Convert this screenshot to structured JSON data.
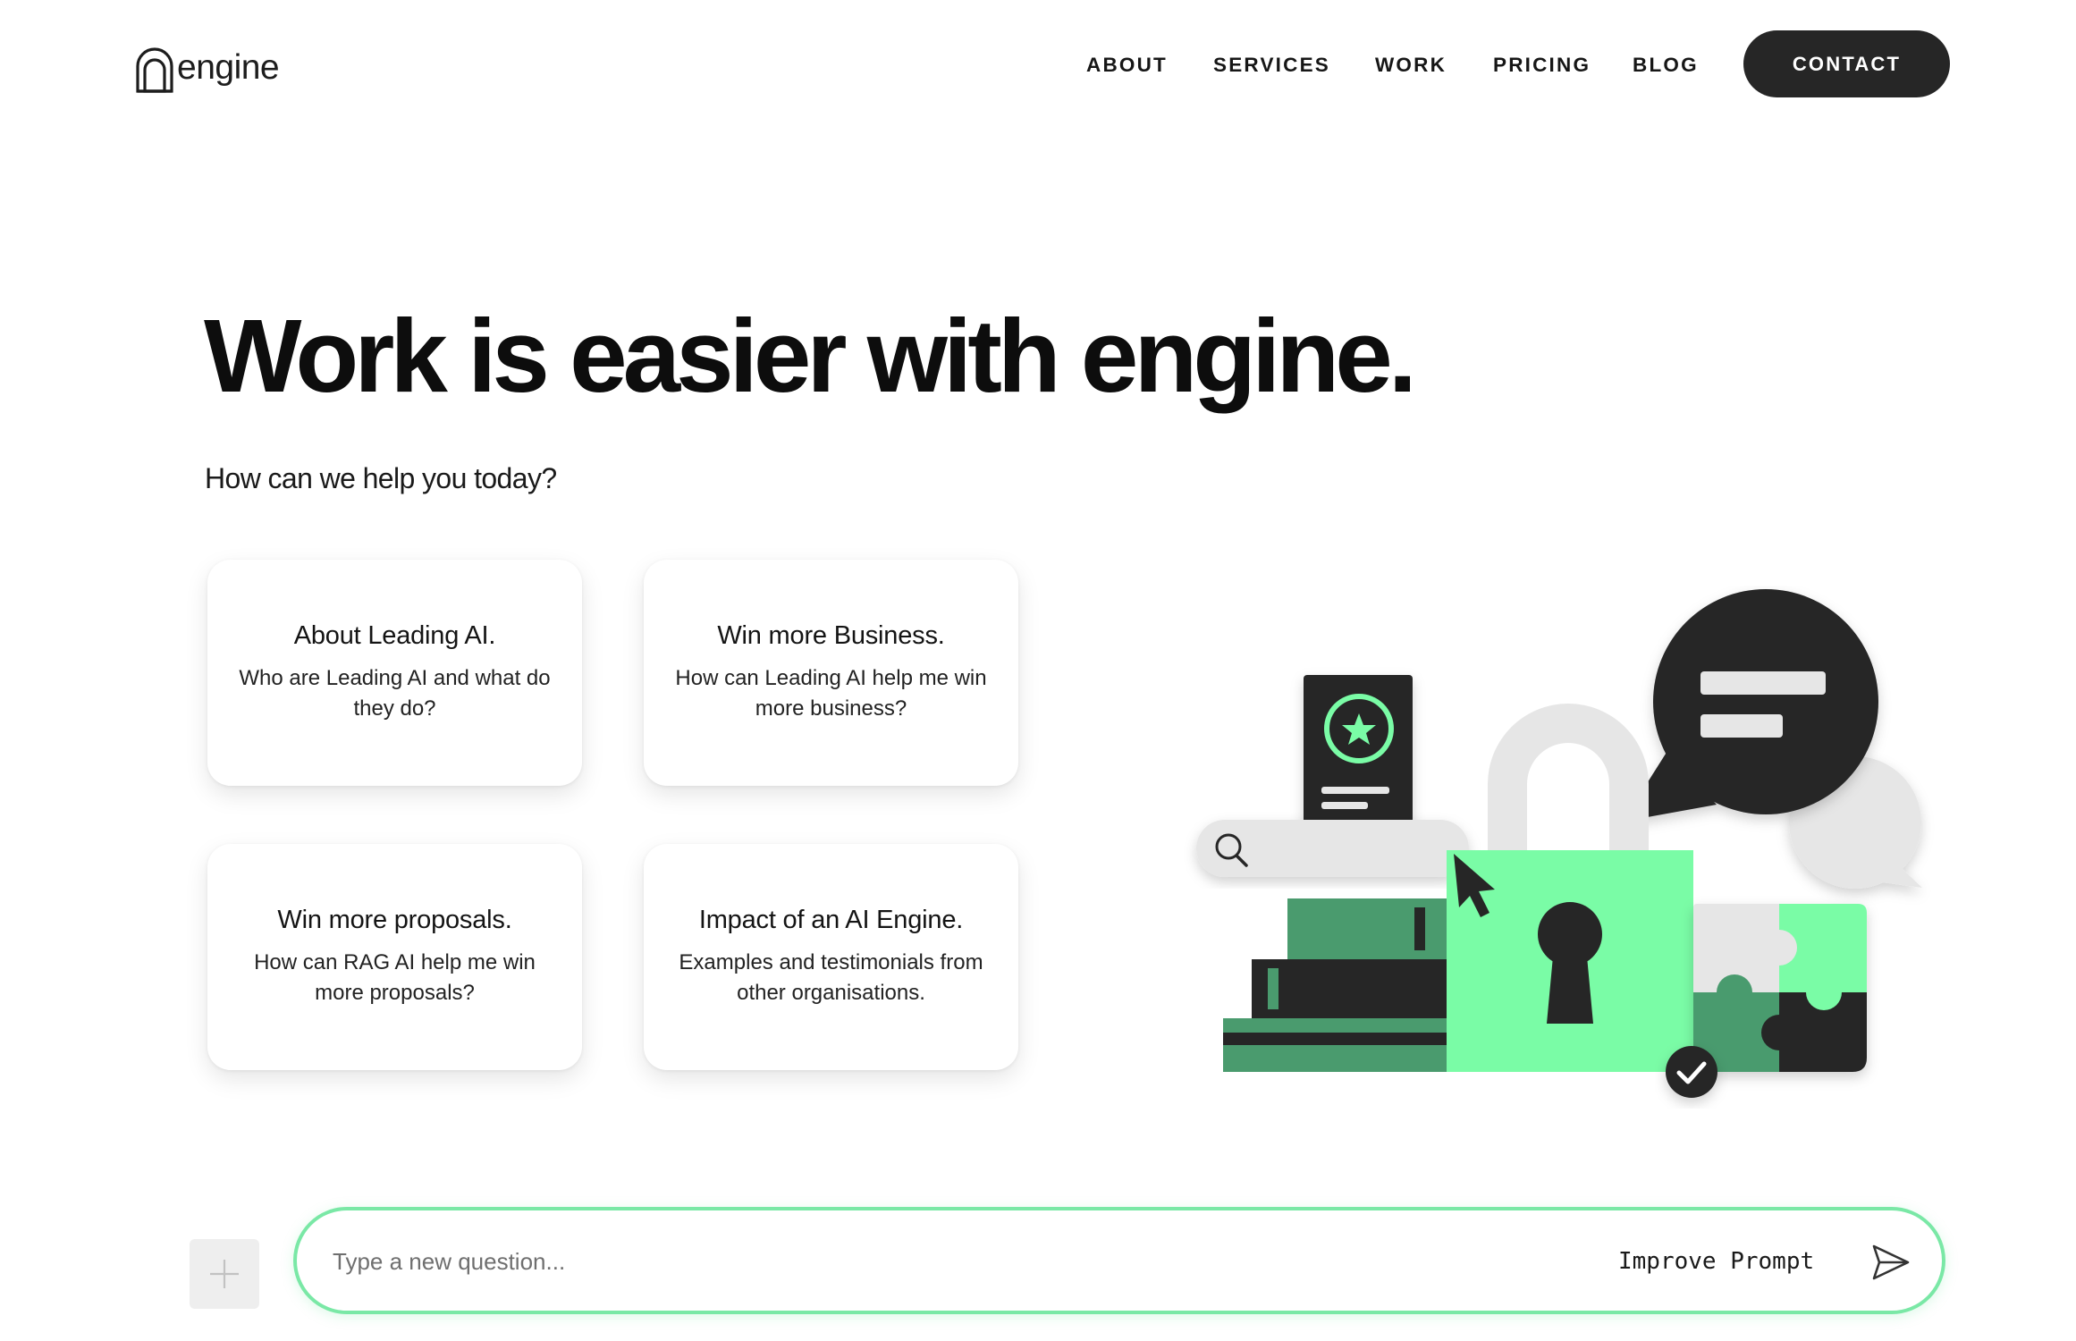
{
  "header": {
    "logo_text": "engine",
    "nav": [
      {
        "label": "ABOUT"
      },
      {
        "label": "SERVICES"
      },
      {
        "label": "WORK"
      },
      {
        "label": "PRICING"
      },
      {
        "label": "BLOG"
      }
    ],
    "contact_label": "CONTACT"
  },
  "hero": {
    "title": "Work is easier with engine.",
    "subtitle": "How can we help you today?"
  },
  "cards": [
    {
      "title": "About Leading AI.",
      "description": "Who are Leading AI and what do they do?"
    },
    {
      "title": "Win more Business.",
      "description": "How can Leading AI help me win more business?"
    },
    {
      "title": "Win more proposals.",
      "description": "How can RAG AI help me win more proposals?"
    },
    {
      "title": "Impact of an AI Engine.",
      "description": "Examples and testimonials from other organisations."
    }
  ],
  "composer": {
    "placeholder": "Type a new question...",
    "improve_label": "Improve Prompt",
    "plus_icon": "plus-icon",
    "send_icon": "send-icon"
  },
  "colors": {
    "accent_green": "#7afca6",
    "dark_green": "#4a9b6e",
    "dark": "#262626",
    "light_gray": "#e6e6e6",
    "composer_border": "#7ae8a6"
  }
}
